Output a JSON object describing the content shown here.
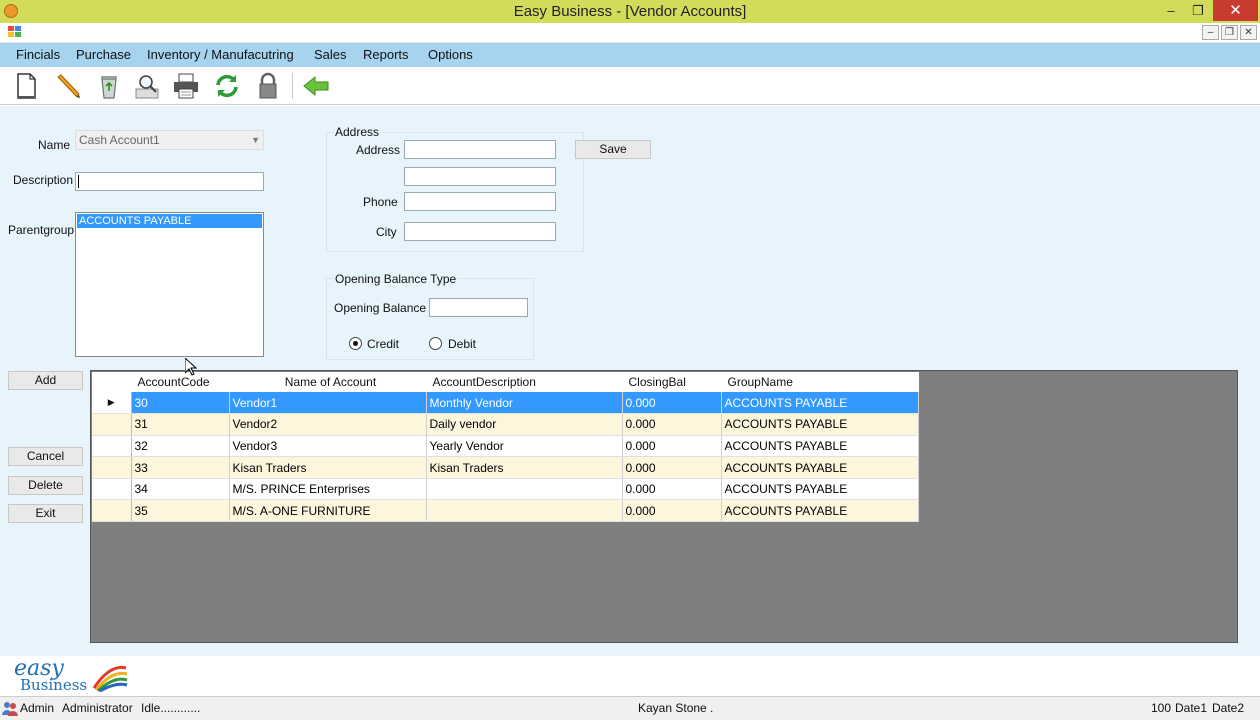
{
  "window": {
    "title": "Easy Business - [Vendor Accounts]",
    "minimize": "–",
    "restore": "❐",
    "close": "✕"
  },
  "mdi": {
    "minimize": "–",
    "restore": "❐",
    "close": "✕"
  },
  "menu": [
    "Fincials",
    "Purchase",
    "Inventory / Manufacutring",
    "Sales",
    "Reports",
    "Options"
  ],
  "toolbar": [
    "new-document-icon",
    "edit-pencil-icon",
    "recycle-bin-icon",
    "search-magnifier-icon",
    "printer-icon",
    "refresh-icon",
    "lock-icon",
    "back-arrow-icon"
  ],
  "form": {
    "name_label": "Name",
    "name_value": "Cash Account1",
    "description_label": "Description",
    "description_value": "",
    "parentgroup_label": "Parentgroup",
    "parentgroup_selected": "ACCOUNTS PAYABLE",
    "address_group_label": "Address",
    "address_label": "Address",
    "address_value": "",
    "address2_value": "",
    "phone_label": "Phone",
    "phone_value": "",
    "city_label": "City",
    "city_value": "",
    "save_label": "Save",
    "opening_group_label": "Opening Balance Type",
    "opening_balance_label": "Opening Balance",
    "opening_balance_value": "",
    "credit_label": "Credit",
    "debit_label": "Debit",
    "balance_type_selected": "Credit"
  },
  "buttons": {
    "add": "Add",
    "cancel": "Cancel",
    "delete": "Delete",
    "exit": "Exit"
  },
  "grid": {
    "columns": [
      "AccountCode",
      "Name of Account",
      "AccountDescription",
      "ClosingBal",
      "GroupName"
    ],
    "rows": [
      [
        "30",
        "Vendor1",
        "Monthly Vendor",
        "0.000",
        "ACCOUNTS PAYABLE"
      ],
      [
        "31",
        "Vendor2",
        "Daily vendor",
        "0.000",
        "ACCOUNTS PAYABLE"
      ],
      [
        "32",
        "Vendor3",
        "Yearly Vendor",
        "0.000",
        "ACCOUNTS PAYABLE"
      ],
      [
        "33",
        "Kisan Traders",
        "Kisan Traders",
        "0.000",
        "ACCOUNTS PAYABLE"
      ],
      [
        "34",
        "M/S. PRINCE Enterprises",
        "",
        "0.000",
        "ACCOUNTS PAYABLE"
      ],
      [
        "35",
        "M/S. A-ONE FURNITURE",
        "",
        "0.000",
        "ACCOUNTS PAYABLE"
      ]
    ],
    "selected_row": 0
  },
  "logo": {
    "line1": "easy",
    "line2": "Business"
  },
  "status": {
    "user": "Admin",
    "role": "Administrator",
    "state": "Idle............",
    "company": "Kayan Stone .",
    "count": "100",
    "date1": "Date1",
    "date2": "Date2"
  }
}
